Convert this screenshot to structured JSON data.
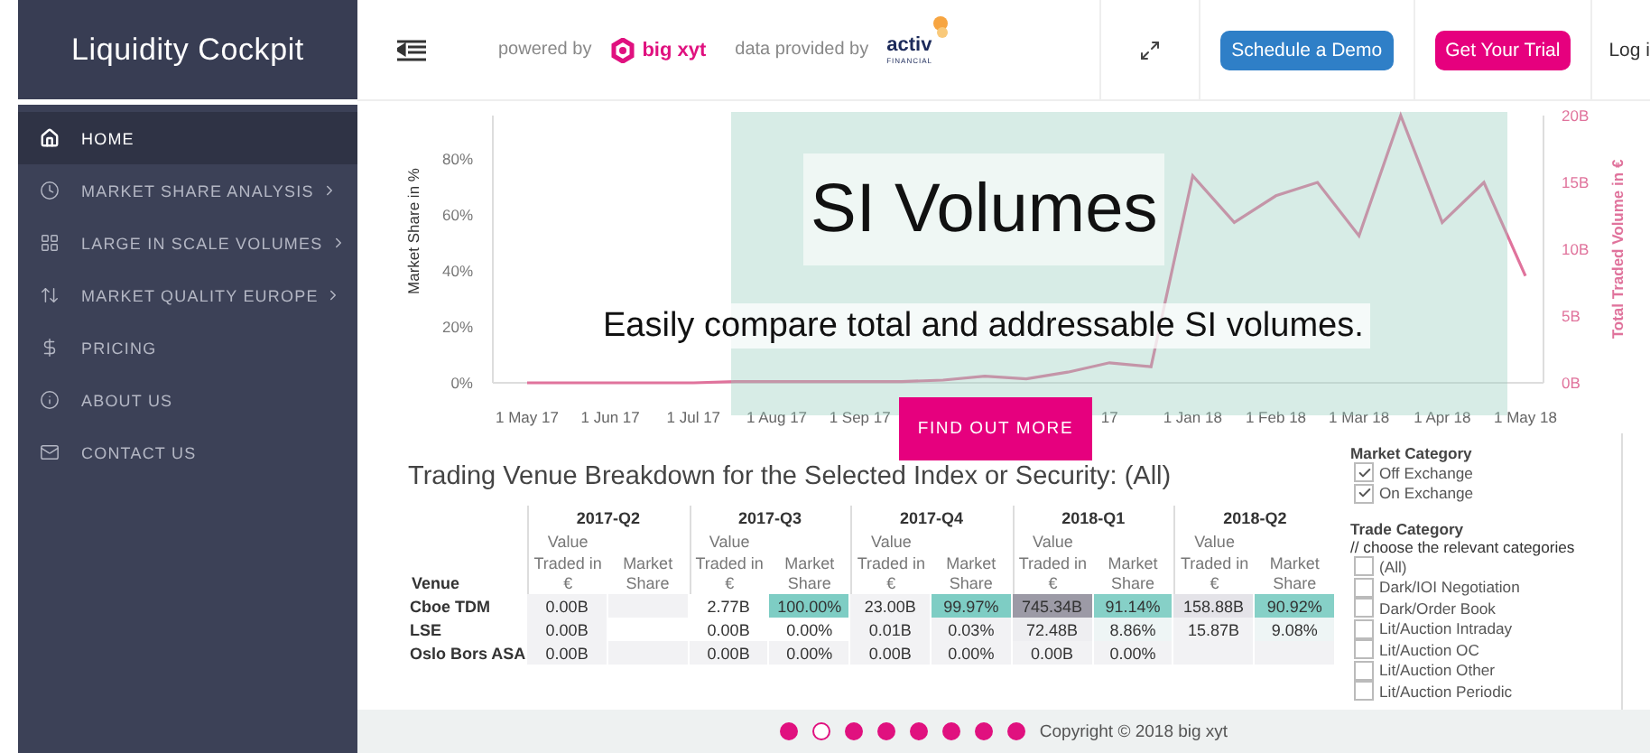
{
  "app_title": "Liquidity Cockpit",
  "header": {
    "powered_by": "powered by",
    "brand": "big xyt",
    "data_by": "data provided by",
    "provider": "activ",
    "provider_sub": "FINANCIAL",
    "buttons": [
      {
        "label": "Schedule a Demo",
        "kind": "primary"
      },
      {
        "label": "Get Your Trial",
        "kind": "accent"
      }
    ],
    "login": "Log i"
  },
  "sidebar": {
    "items": [
      {
        "label": "HOME",
        "selected": true,
        "submenu": false
      },
      {
        "label": "MARKET SHARE ANALYSIS",
        "selected": false,
        "submenu": true
      },
      {
        "label": "LARGE IN SCALE VOLUMES",
        "selected": false,
        "submenu": true
      },
      {
        "label": "MARKET QUALITY EUROPE",
        "selected": false,
        "submenu": true
      },
      {
        "label": "PRICING",
        "selected": false,
        "submenu": false
      },
      {
        "label": "ABOUT US",
        "selected": false,
        "submenu": false
      },
      {
        "label": "CONTACT US",
        "selected": false,
        "submenu": false
      }
    ]
  },
  "chart": {
    "left_axis": {
      "label": "Market Share in %",
      "ticks": [
        "80%",
        "60%",
        "40%",
        "20%",
        "0%"
      ]
    },
    "chart_data": {
      "type": "line",
      "ylabel": "Total Traded Volume in €",
      "ylim": [
        0,
        20
      ],
      "yticks": [
        {
          "value": 0,
          "label": "0B"
        },
        {
          "value": 5,
          "label": "5B"
        },
        {
          "value": 10,
          "label": "10B"
        },
        {
          "value": 15,
          "label": "15B"
        },
        {
          "value": 20,
          "label": "20B"
        }
      ],
      "categories": [
        "1 May 17",
        null,
        "1 Jun 17",
        null,
        "1 Jul 17",
        null,
        "1 Aug 17",
        null,
        "1 Sep 17",
        null,
        null,
        null,
        null,
        null,
        "17",
        null,
        "1 Jan 18",
        null,
        "1 Feb 18",
        null,
        "1 Mar 18",
        null,
        "1 Apr 18",
        null,
        "1 May 18"
      ],
      "series": [
        {
          "color": "#e0739c",
          "values": [
            0,
            0,
            0,
            0,
            0,
            0.1,
            0.1,
            0.1,
            0.1,
            0.1,
            0.2,
            0.5,
            0.3,
            0.8,
            1.5,
            1.2,
            15.5,
            12,
            14,
            15,
            11,
            20,
            12,
            15,
            8
          ]
        }
      ]
    }
  },
  "slide": {
    "title": "SI Volumes",
    "subtitle": "Easily compare total and addressable SI volumes.",
    "button": "FIND OUT MORE",
    "dots": [
      {
        "selected": false
      },
      {
        "selected": true
      },
      {
        "selected": false
      },
      {
        "selected": false
      },
      {
        "selected": false
      },
      {
        "selected": false
      },
      {
        "selected": false
      },
      {
        "selected": false
      }
    ]
  },
  "table": {
    "title": "Trading Venue Breakdown for the Selected Index or Security: (All)",
    "venue_header": "Venue",
    "quarters": [
      {
        "label": "2017-Q2",
        "columns": [
          "Value Traded in €",
          "Market Share"
        ]
      },
      {
        "label": "2017-Q3",
        "columns": [
          "Value Traded in €",
          "Market Share"
        ]
      },
      {
        "label": "2017-Q4",
        "columns": [
          "Value Traded in €",
          "Market Share"
        ]
      },
      {
        "label": "2018-Q1",
        "columns": [
          "Value Traded in €",
          "Market Share"
        ]
      },
      {
        "label": "2018-Q2",
        "columns": [
          "Value Traded in €",
          "Market Share"
        ]
      }
    ],
    "rows": [
      {
        "venue": "Cboe TDM",
        "cells": [
          {
            "text": "0.00B",
            "color": "#f2f2f4"
          },
          {
            "text": "",
            "color": "#f2f2f4"
          },
          {
            "text": "2.77B",
            "color": "#ffffff"
          },
          {
            "text": "100.00%",
            "color": "#7ecdc4"
          },
          {
            "text": "23.00B",
            "color": "#f2f2f4"
          },
          {
            "text": "99.97%",
            "color": "#7ecdc4"
          },
          {
            "text": "745.34B",
            "color": "#9c9aa6"
          },
          {
            "text": "91.14%",
            "color": "#86d0c7"
          },
          {
            "text": "158.88B",
            "color": "#e4e3e8"
          },
          {
            "text": "90.92%",
            "color": "#86d0c7"
          }
        ]
      },
      {
        "venue": "LSE",
        "cells": [
          {
            "text": "0.00B",
            "color": "#f2f2f4"
          },
          {
            "text": ""
          },
          {
            "text": "0.00B",
            "color": "#ffffff"
          },
          {
            "text": "0.00%",
            "color": "#ffffff"
          },
          {
            "text": "0.01B",
            "color": "#f2f2f4"
          },
          {
            "text": "0.03%",
            "color": "#f2f2f4"
          },
          {
            "text": "72.48B",
            "color": "#eeeef1"
          },
          {
            "text": "8.86%",
            "color": "#eef5f5"
          },
          {
            "text": "15.87B",
            "color": "#f2f2f4"
          },
          {
            "text": "9.08%",
            "color": "#eef5f5"
          }
        ]
      },
      {
        "venue": "Oslo Bors ASA",
        "cells": [
          {
            "text": "0.00B",
            "color": "#f2f2f4"
          },
          {
            "text": "",
            "color": "#f2f2f4"
          },
          {
            "text": "0.00B",
            "color": "#f2f2f4"
          },
          {
            "text": "0.00%",
            "color": "#f2f2f4"
          },
          {
            "text": "0.00B",
            "color": "#f2f2f4"
          },
          {
            "text": "0.00%",
            "color": "#f2f2f4"
          },
          {
            "text": "0.00B",
            "color": "#f2f2f4"
          },
          {
            "text": "0.00%",
            "color": "#f2f2f4"
          },
          {
            "text": "",
            "color": "#f2f2f4"
          },
          {
            "text": "",
            "color": "#f2f2f4"
          }
        ]
      }
    ]
  },
  "filters": {
    "market_title": "Market Category",
    "market": [
      {
        "label": "Off Exchange",
        "checked": true
      },
      {
        "label": "On Exchange",
        "checked": true
      }
    ],
    "trade_title": "Trade Category",
    "trade_hint": "// choose the relevant categories",
    "trade": [
      {
        "label": "(All)",
        "checked": false
      },
      {
        "label": "Dark/IOI Negotiation",
        "checked": false
      },
      {
        "label": "Dark/Order Book",
        "checked": false
      },
      {
        "label": "Lit/Auction Intraday",
        "checked": false
      },
      {
        "label": "Lit/Auction OC",
        "checked": false
      },
      {
        "label": "Lit/Auction Other",
        "checked": false
      },
      {
        "label": "Lit/Auction Periodic",
        "checked": false
      }
    ]
  },
  "footer": "Copyright © 2018 big xyt"
}
